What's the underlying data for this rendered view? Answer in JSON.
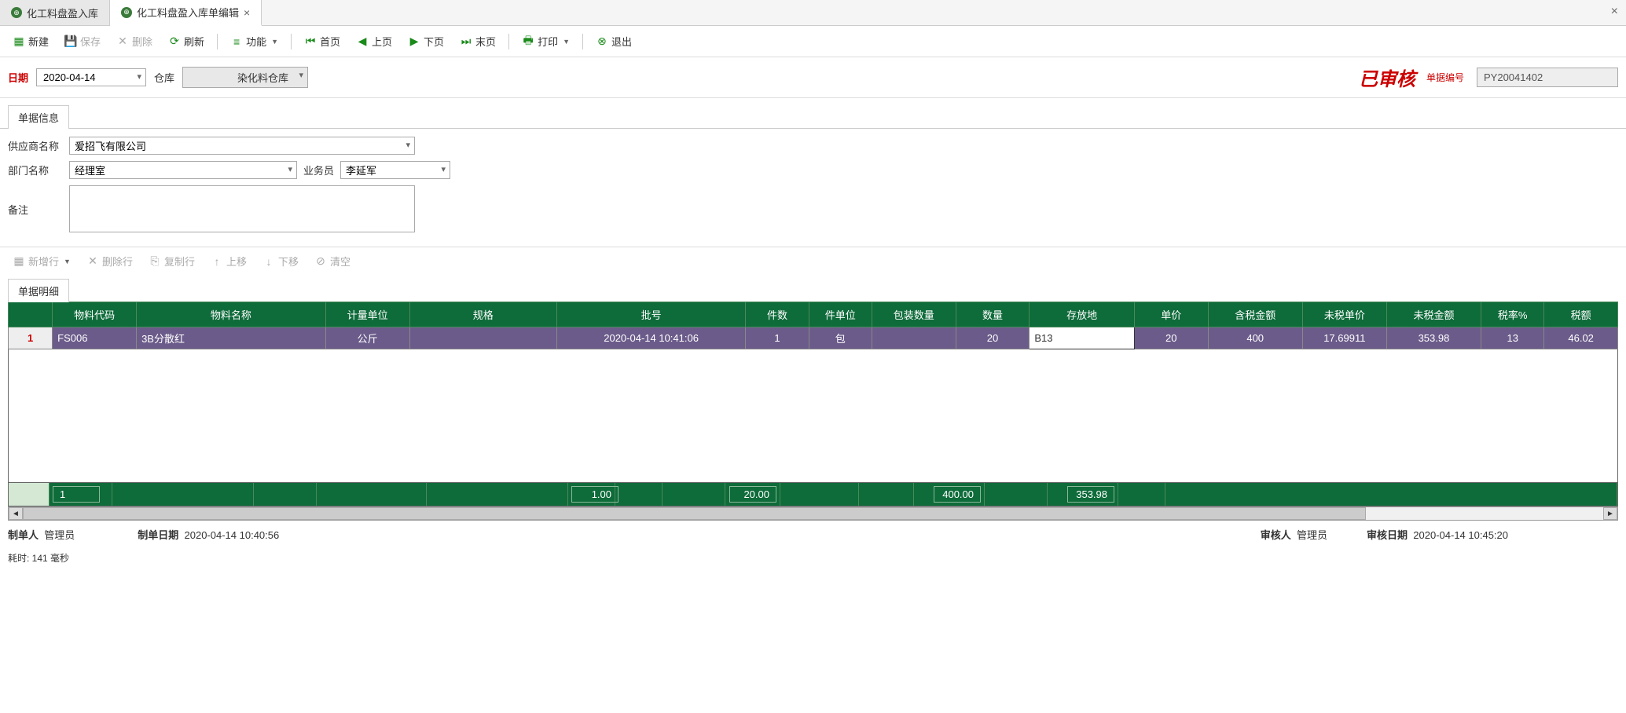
{
  "tabs": [
    {
      "label": "化工料盘盈入库",
      "active": false
    },
    {
      "label": "化工料盘盈入库单编辑",
      "active": true
    }
  ],
  "toolbar": {
    "new": "新建",
    "save": "保存",
    "delete": "删除",
    "refresh": "刷新",
    "functions": "功能",
    "first": "首页",
    "prev": "上页",
    "next": "下页",
    "last": "末页",
    "print": "打印",
    "exit": "退出"
  },
  "filter": {
    "date_label": "日期",
    "date_value": "2020-04-14",
    "warehouse_label": "仓库",
    "warehouse_value": "染化料仓库",
    "approved_stamp": "已审核",
    "doc_no_label": "单据编号",
    "doc_no_value": "PY20041402"
  },
  "info_section": {
    "tab": "单据信息",
    "supplier_label": "供应商名称",
    "supplier_value": "爱招飞有限公司",
    "dept_label": "部门名称",
    "dept_value": "经理室",
    "salesman_label": "业务员",
    "salesman_value": "李延军",
    "remark_label": "备注",
    "remark_value": ""
  },
  "row_toolbar": {
    "add": "新增行",
    "del": "删除行",
    "copy": "复制行",
    "up": "上移",
    "down": "下移",
    "clear": "清空"
  },
  "detail": {
    "tab": "单据明细",
    "columns": [
      "物料代码",
      "物料名称",
      "计量单位",
      "规格",
      "批号",
      "件数",
      "件单位",
      "包装数量",
      "数量",
      "存放地",
      "单价",
      "含税金额",
      "未税单价",
      "未税金额",
      "税率%",
      "税额"
    ],
    "rows": [
      {
        "num": "1",
        "code": "FS006",
        "name": "3B分散红",
        "unit": "公斤",
        "spec": "",
        "batch": "2020-04-14 10:41:06",
        "pcs": "1",
        "pcs_unit": "包",
        "pack_qty": "",
        "qty": "20",
        "location": "B13",
        "price": "20",
        "tax_amount": "400",
        "notax_price": "17.69911",
        "notax_amount": "353.98",
        "tax_rate": "13",
        "tax": "46.02"
      }
    ],
    "summary": {
      "count": "1",
      "pcs": "1.00",
      "qty": "20.00",
      "tax_amount": "400.00",
      "notax_amount": "353.98"
    }
  },
  "footer": {
    "creator_label": "制单人",
    "creator": "管理员",
    "create_date_label": "制单日期",
    "create_date": "2020-04-14 10:40:56",
    "approver_label": "审核人",
    "approver": "管理员",
    "approve_date_label": "审核日期",
    "approve_date": "2020-04-14 10:45:20",
    "timing": "耗时: 141 毫秒"
  }
}
